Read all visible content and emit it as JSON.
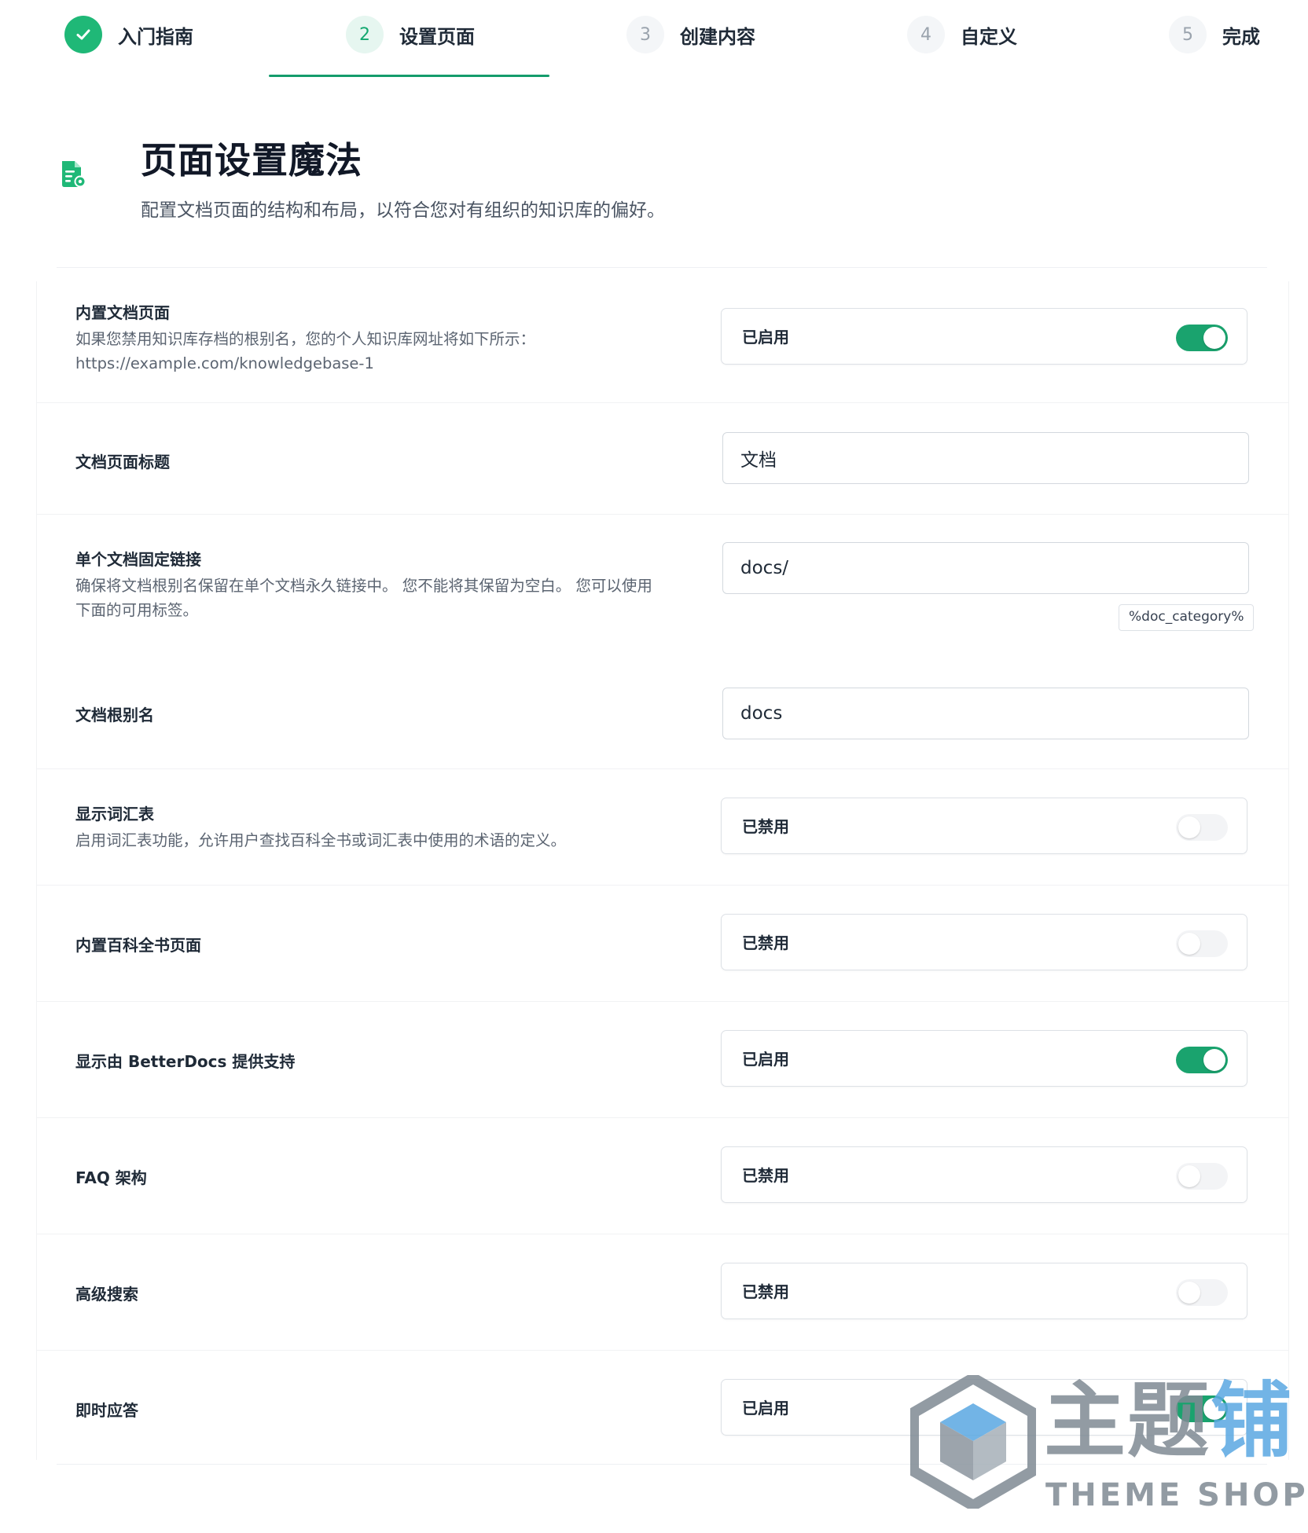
{
  "stepper": {
    "steps": [
      {
        "number": "",
        "label": "入门指南",
        "state": "done"
      },
      {
        "number": "2",
        "label": "设置页面",
        "state": "active"
      },
      {
        "number": "3",
        "label": "创建内容",
        "state": "pending"
      },
      {
        "number": "4",
        "label": "自定义",
        "state": "pending"
      },
      {
        "number": "5",
        "label": "完成",
        "state": "pending"
      }
    ]
  },
  "header": {
    "title": "页面设置魔法",
    "subtitle": "配置文档页面的结构和布局，以符合您对有组织的知识库的偏好。",
    "icon": "document-settings-icon"
  },
  "settings": {
    "builtin_docs_page": {
      "label": "内置文档页面",
      "desc_line1": "如果您禁用知识库存档的根别名，您的个人知识库网址将如下所示：",
      "desc_line2": "https://example.com/knowledgebase-1",
      "status": "已启用",
      "enabled": true
    },
    "docs_page_title": {
      "label": "文档页面标题",
      "value": "文档"
    },
    "single_doc_permalink": {
      "label": "单个文档固定链接",
      "desc": "确保将文档根别名保留在单个文档永久链接中。 您不能将其保留为空白。 您可以使用下面的可用标签。",
      "value": "docs/",
      "tag": "%doc_category%"
    },
    "docs_slug": {
      "label": "文档根别名",
      "value": "docs"
    },
    "show_glossary": {
      "label": "显示词汇表",
      "desc": "启用词汇表功能，允许用户查找百科全书或词汇表中使用的术语的定义。",
      "status": "已禁用",
      "enabled": false
    },
    "builtin_encyclopedia": {
      "label": "内置百科全书页面",
      "status": "已禁用",
      "enabled": false
    },
    "powered_by": {
      "label": "显示由 BetterDocs 提供支持",
      "status": "已启用",
      "enabled": true
    },
    "faq_schema": {
      "label": "FAQ 架构",
      "status": "已禁用",
      "enabled": false
    },
    "advanced_search": {
      "label": "高级搜索",
      "status": "已禁用",
      "enabled": false
    },
    "instant_answer": {
      "label": "即时应答",
      "status": "已启用",
      "enabled": true
    }
  },
  "watermark": {
    "main": "主题",
    "accent": "铺",
    "sub": "THEME SHOP"
  },
  "colors": {
    "accent": "#1aa36e",
    "active_step_bg": "#e6f6f0",
    "underline": "#149c6c"
  }
}
